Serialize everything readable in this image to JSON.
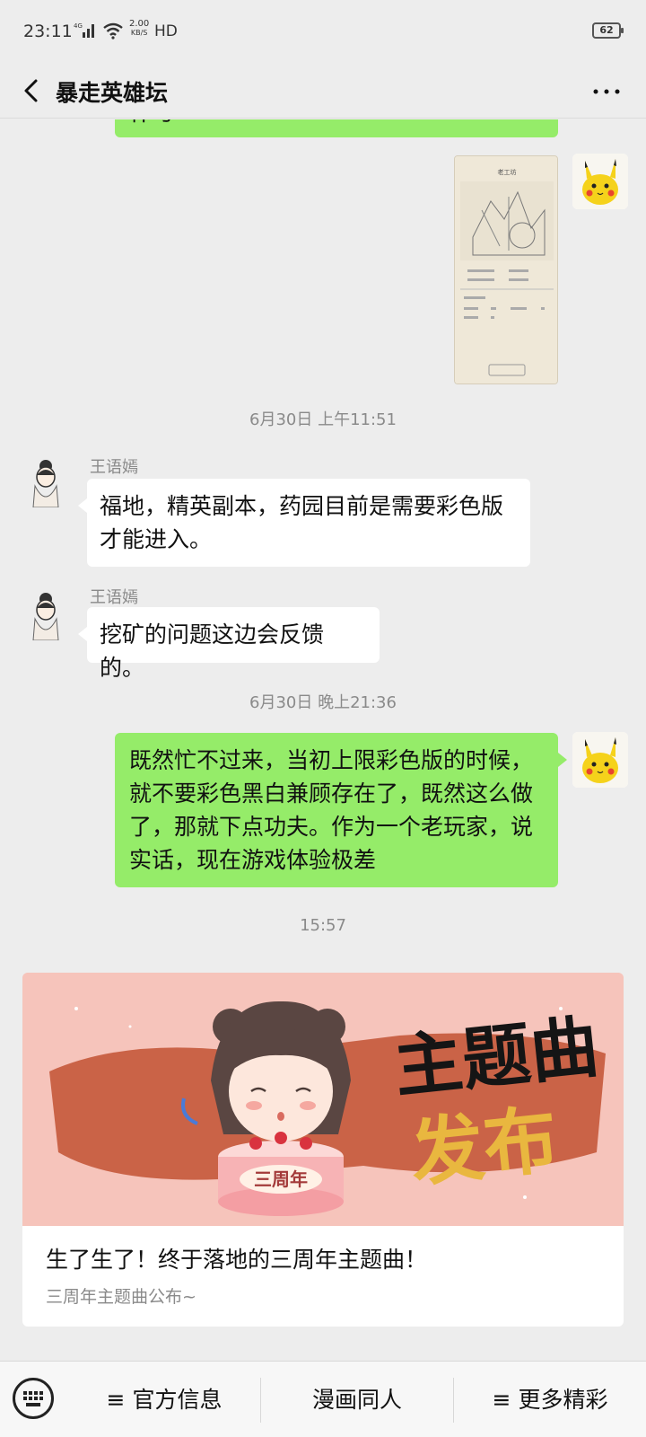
{
  "status_bar": {
    "time": "23:11",
    "network": "4G",
    "speed_value": "2.00",
    "speed_unit": "KB/S",
    "hd": "HD",
    "battery": "62"
  },
  "header": {
    "title": "暴走英雄坛",
    "back_icon": "chevron-left-icon",
    "more_icon": "more-dots-icon"
  },
  "messages": [
    {
      "type": "text",
      "side": "right",
      "text": "什与"
    },
    {
      "type": "image",
      "side": "right",
      "image_title": "老工坊"
    },
    {
      "type": "timestamp",
      "text": "6月30日 上午11:51"
    },
    {
      "type": "text",
      "side": "left",
      "sender": "王语嫣",
      "lines": [
        "福地，精英副本，药园目前是需要彩色版",
        "才能进入。"
      ]
    },
    {
      "type": "text",
      "side": "left",
      "sender": "王语嫣",
      "lines": [
        "挖矿的问题这边会反馈的。"
      ]
    },
    {
      "type": "timestamp",
      "text": "6月30日 晚上21:36"
    },
    {
      "type": "text",
      "side": "right",
      "lines": [
        "既然忙不过来，当初上限彩色版的时候，",
        "就不要彩色黑白兼顾存在了，既然这么做",
        "了，那就下点功夫。作为一个老玩家，说",
        "实话，现在游戏体验极差"
      ]
    },
    {
      "type": "timestamp",
      "text": "15:57"
    }
  ],
  "article": {
    "cover_text_top": "主题曲",
    "cover_text_bottom": "发布",
    "cake_text": "三周年",
    "title": "生了生了！终于落地的三周年主题曲！",
    "description": "三周年主题曲公布~"
  },
  "bottom_menu": {
    "keyboard_icon": "keyboard-icon",
    "items": [
      {
        "label": "≡ 官方信息"
      },
      {
        "label": "漫画同人"
      },
      {
        "label": "≡ 更多精彩"
      }
    ]
  },
  "colors": {
    "background": "#ededed",
    "bubble_green": "#95ec69",
    "bubble_white": "#ffffff",
    "timestamp_gray": "#8a8a8a"
  }
}
